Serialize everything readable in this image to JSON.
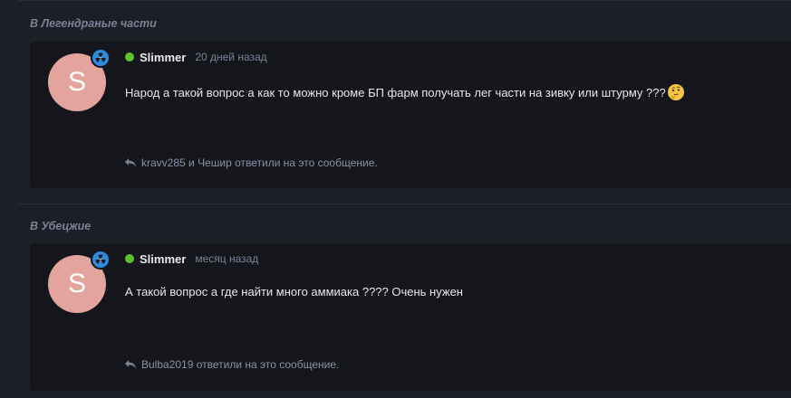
{
  "posts": [
    {
      "section_title": "В Легендраные части",
      "avatar_letter": "S",
      "username": "Slimmer",
      "time": "20 дней назад",
      "message": "Народ а такой вопрос а как то можно кроме БП фарм получать лег части на зивку или штурму ???",
      "emoji": "thinking-face-emoji",
      "replies": "kravv285 и Чешир ответили на это сообщение."
    },
    {
      "section_title": "В Убецжие",
      "avatar_letter": "S",
      "username": "Slimmer",
      "time": "месяц назад",
      "message": "А такой вопрос а где найти много аммиака ???? Очень нужен",
      "replies": "Bulba2019 ответили на это сообщение."
    }
  ],
  "colors": {
    "background": "#1c1f26",
    "card": "#14161b",
    "avatar": "#e2a49c",
    "badge": "#2f8be0",
    "online": "#5ec22c"
  }
}
